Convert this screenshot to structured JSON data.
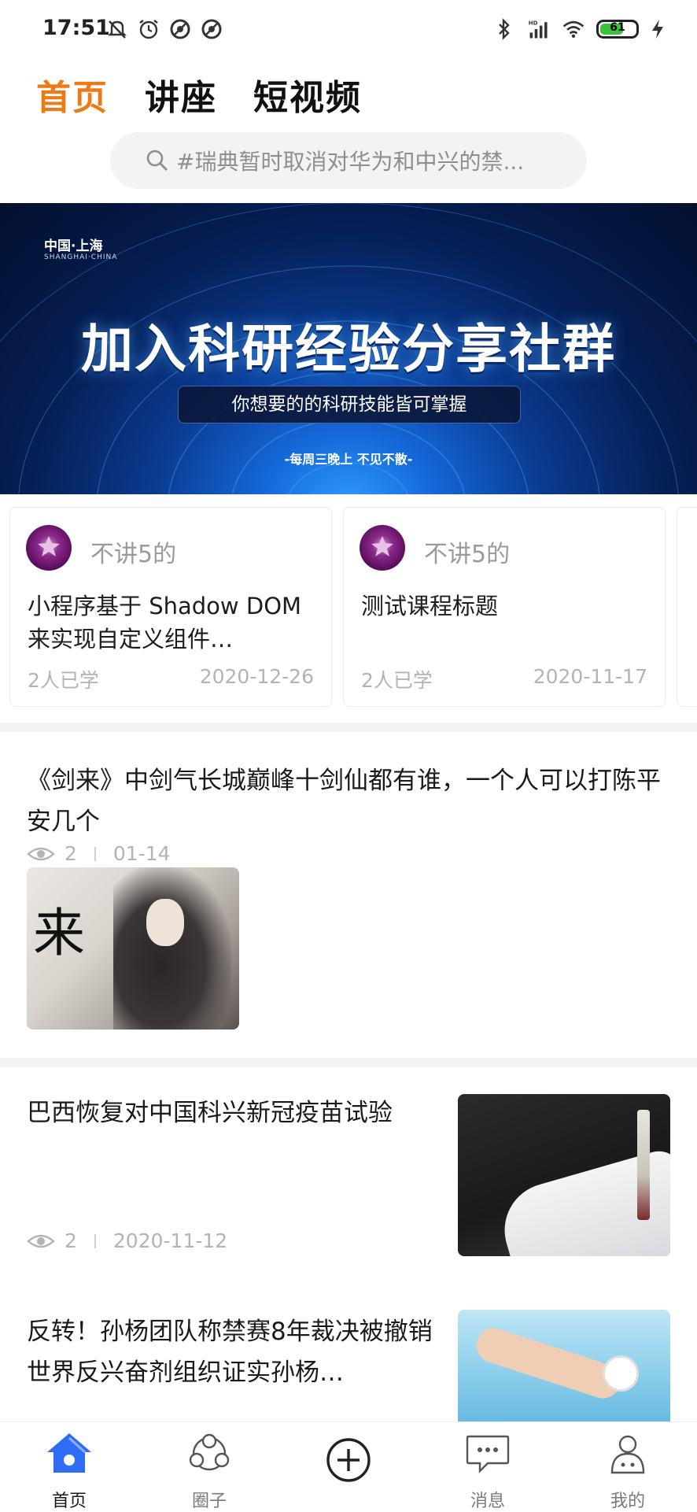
{
  "status_bar": {
    "time": "17:51",
    "battery_level": "61",
    "network": "HD"
  },
  "tabs": [
    {
      "label": "首页",
      "active": true
    },
    {
      "label": "讲座",
      "active": false
    },
    {
      "label": "短视频",
      "active": false
    }
  ],
  "search": {
    "placeholder": "#瑞典暂时取消对华为和中兴的禁..."
  },
  "banner": {
    "location": "中国·上海",
    "location_en": "SHANGHAI·CHINA",
    "title": "加入科研经验分享社群",
    "subtitle": "你想要的的科研技能皆可掌握",
    "footer": "-每周三晚上 不见不散-"
  },
  "courses": [
    {
      "author": "不讲5的",
      "title": "小程序基于 Shadow DOM 来实现自定义组件…",
      "learners": "2人已学",
      "date": "2020-12-26"
    },
    {
      "author": "不讲5的",
      "title": "测试课程标题",
      "learners": "2人已学",
      "date": "2020-11-17"
    }
  ],
  "articles": [
    {
      "title": "《剑来》中剑气长城巅峰十剑仙都有谁，一个人可以打陈平安几个",
      "views": "2",
      "date": "01-14",
      "image_icon": "anime-character-image"
    },
    {
      "title": "巴西恢复对中国科兴新冠疫苗试验",
      "views": "2",
      "date": "2020-11-12",
      "image_icon": "vaccine-vial-image"
    },
    {
      "title": "反转！孙杨团队称禁赛8年裁决被撤销 世界反兴奋剂组织证实孙杨…",
      "image_icon": "swimmer-image"
    }
  ],
  "bottom_nav": [
    {
      "label": "首页",
      "icon": "home-icon",
      "active": true
    },
    {
      "label": "圈子",
      "icon": "circle-group-icon",
      "active": false
    },
    {
      "label": "",
      "icon": "add-circle-icon",
      "active": false
    },
    {
      "label": "消息",
      "icon": "message-icon",
      "active": false
    },
    {
      "label": "我的",
      "icon": "profile-icon",
      "active": false
    }
  ],
  "colors": {
    "accent": "#ee7a16",
    "nav_active": "#2f6cf6",
    "muted_text": "#b3b3b3"
  }
}
